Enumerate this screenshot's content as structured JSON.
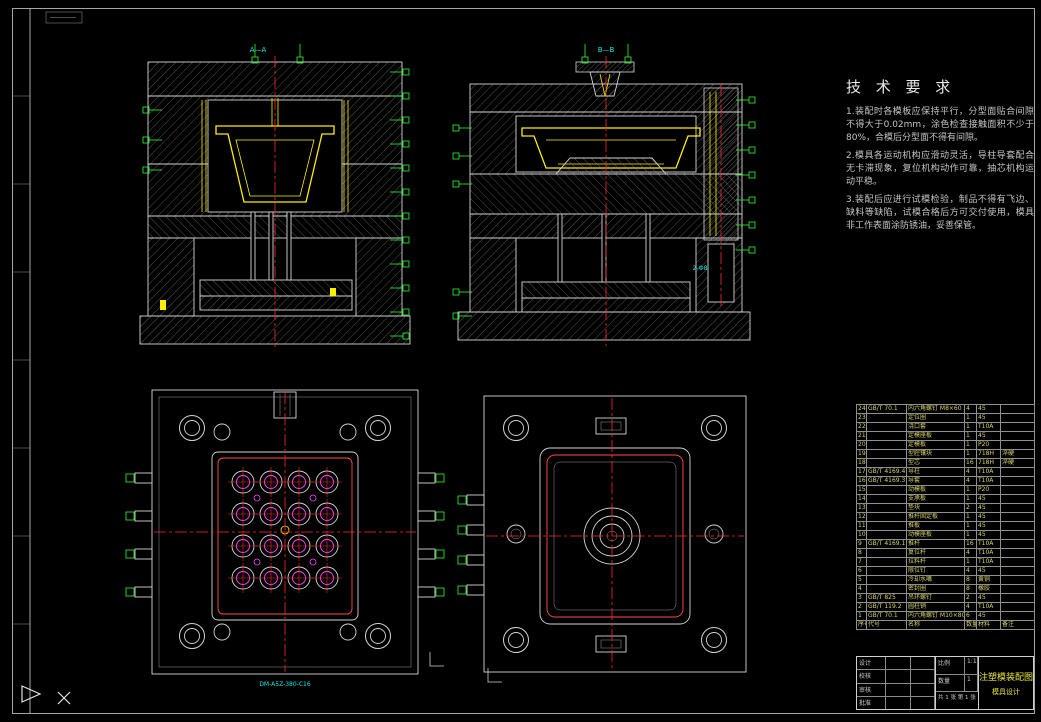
{
  "colors": {
    "background": "#000000",
    "line": "#d4d4d4",
    "highlight": "#ffee00",
    "dimension": "#2bff2b",
    "centerline": "#ff2a2a",
    "annotation": "#19e6e6",
    "detail": "#ff4dff"
  },
  "views": {
    "front": {
      "label": "A—A"
    },
    "side": {
      "label": "B—B",
      "note": "2-Ф8"
    },
    "core": {
      "caption": "DM-A5Z-380-C16"
    },
    "cavity": {}
  },
  "tech_requirements": {
    "title": "技 术 要 求",
    "items": [
      "1.装配时各模板应保持平行，分型面贴合间隙不得大于0.02mm，涂色检查接触面积不少于80%，合模后分型面不得有间隙。",
      "2.模具各运动机构应滑动灵活，导柱导套配合无卡滞现象，复位机构动作可靠，抽芯机构运动平稳。",
      "3.装配后应进行试模检验，制品不得有飞边、缺料等缺陷，试模合格后方可交付使用，模具非工作表面涂防锈油，妥善保管。"
    ]
  },
  "bom": {
    "rows": [
      [
        "24",
        "GB/T 70.1",
        "内六角螺钉 M8×60",
        "4",
        "45",
        ""
      ],
      [
        "23",
        "",
        "定位圈",
        "1",
        "45",
        ""
      ],
      [
        "22",
        "",
        "浇口套",
        "1",
        "T10A",
        ""
      ],
      [
        "21",
        "",
        "定模座板",
        "1",
        "45",
        ""
      ],
      [
        "20",
        "",
        "定模板",
        "1",
        "P20",
        ""
      ],
      [
        "19",
        "",
        "型腔镶块",
        "1",
        "718H",
        "淬硬"
      ],
      [
        "18",
        "",
        "型芯",
        "16",
        "718H",
        "淬硬"
      ],
      [
        "17",
        "GB/T 4169.4",
        "导柱",
        "4",
        "T10A",
        ""
      ],
      [
        "16",
        "GB/T 4169.3",
        "导套",
        "4",
        "T10A",
        ""
      ],
      [
        "15",
        "",
        "动模板",
        "1",
        "P20",
        ""
      ],
      [
        "14",
        "",
        "支承板",
        "1",
        "45",
        ""
      ],
      [
        "13",
        "",
        "垫块",
        "2",
        "45",
        ""
      ],
      [
        "12",
        "",
        "推杆固定板",
        "1",
        "45",
        ""
      ],
      [
        "11",
        "",
        "推板",
        "1",
        "45",
        ""
      ],
      [
        "10",
        "",
        "动模座板",
        "1",
        "45",
        ""
      ],
      [
        "9",
        "GB/T 4169.1",
        "推杆",
        "16",
        "T10A",
        ""
      ],
      [
        "8",
        "",
        "复位杆",
        "4",
        "T10A",
        ""
      ],
      [
        "7",
        "",
        "拉料杆",
        "1",
        "T10A",
        ""
      ],
      [
        "6",
        "",
        "限位钉",
        "4",
        "45",
        ""
      ],
      [
        "5",
        "",
        "冷却水嘴",
        "8",
        "黄铜",
        ""
      ],
      [
        "4",
        "",
        "密封圈",
        "8",
        "橡胶",
        ""
      ],
      [
        "3",
        "GB/T 825",
        "吊环螺钉",
        "2",
        "45",
        ""
      ],
      [
        "2",
        "GB/T 119.2",
        "圆柱销",
        "4",
        "T10A",
        ""
      ],
      [
        "1",
        "GB/T 70.1",
        "内六角螺钉 M10×80",
        "6",
        "45",
        ""
      ],
      [
        "序号",
        "代号",
        "名称",
        "数量",
        "材料",
        "备注"
      ]
    ]
  },
  "title_block": {
    "drawing_title": "注塑模装配图",
    "org": "模具设计",
    "fields": [
      {
        "label": "设计"
      },
      {
        "label": "校核"
      },
      {
        "label": "审核"
      },
      {
        "label": "批准"
      }
    ],
    "scale_label": "比例",
    "scale_value": "1:1",
    "qty_label": "数量",
    "qty_value": "1",
    "sheet_info": "共 1 张 第 1 张"
  },
  "ucs": {
    "axis_label": "X"
  }
}
